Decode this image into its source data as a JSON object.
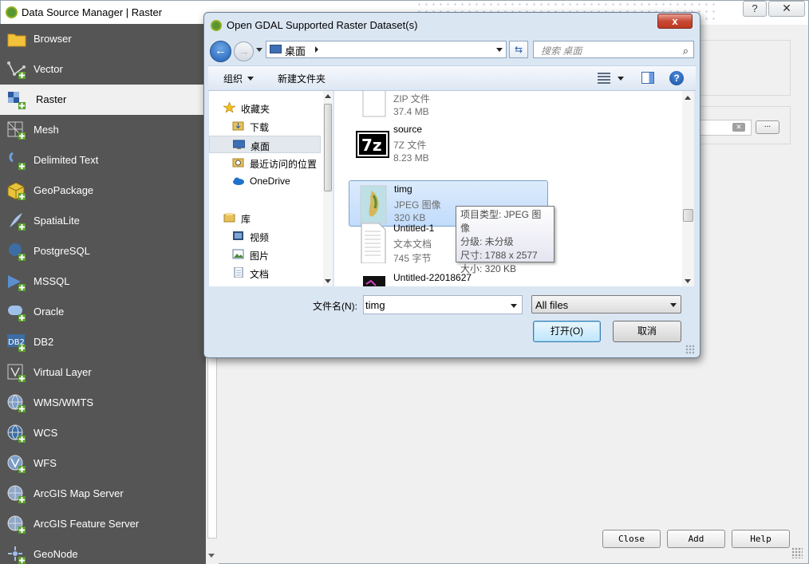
{
  "main_window": {
    "title": "Data Source Manager | Raster",
    "help_label": "?",
    "close_label": "✕"
  },
  "sidebar": {
    "items": [
      {
        "label": "Browser",
        "icon": "folder-icon"
      },
      {
        "label": "Vector",
        "icon": "vector-icon"
      },
      {
        "label": "Raster",
        "icon": "raster-icon"
      },
      {
        "label": "Mesh",
        "icon": "mesh-icon"
      },
      {
        "label": "Delimited Text",
        "icon": "delimited-text-icon"
      },
      {
        "label": "GeoPackage",
        "icon": "geopackage-icon"
      },
      {
        "label": "SpatiaLite",
        "icon": "spatialite-icon"
      },
      {
        "label": "PostgreSQL",
        "icon": "postgresql-icon"
      },
      {
        "label": "MSSQL",
        "icon": "mssql-icon"
      },
      {
        "label": "Oracle",
        "icon": "oracle-icon"
      },
      {
        "label": "DB2",
        "icon": "db2-icon"
      },
      {
        "label": "Virtual Layer",
        "icon": "virtual-layer-icon"
      },
      {
        "label": "WMS/WMTS",
        "icon": "wms-icon"
      },
      {
        "label": "WCS",
        "icon": "wcs-icon"
      },
      {
        "label": "WFS",
        "icon": "wfs-icon"
      },
      {
        "label": "ArcGIS Map Server",
        "icon": "arcgis-map-icon"
      },
      {
        "label": "ArcGIS Feature Server",
        "icon": "arcgis-feature-icon"
      },
      {
        "label": "GeoNode",
        "icon": "geonode-icon"
      }
    ],
    "active_index": 2
  },
  "source_panel": {
    "browse_label": "...",
    "clear_label": "✕"
  },
  "bottom_buttons": {
    "close": "Close",
    "add": "Add",
    "help": "Help"
  },
  "dialog": {
    "title": "Open GDAL Supported Raster Dataset(s)",
    "close_label": "x",
    "address": "桌面",
    "search_placeholder": "搜索 桌面",
    "toolbar": {
      "organize": "组织",
      "new_folder": "新建文件夹",
      "help": "?"
    },
    "nav_items": [
      {
        "label": "收藏夹",
        "icon": "star-icon"
      },
      {
        "label": "下载",
        "icon": "downloads-folder-icon"
      },
      {
        "label": "桌面",
        "icon": "desktop-icon"
      },
      {
        "label": "最近访问的位置",
        "icon": "recent-places-icon"
      },
      {
        "label": "OneDrive",
        "icon": "onedrive-icon"
      },
      {
        "label": "库",
        "icon": "library-icon"
      },
      {
        "label": "视频",
        "icon": "video-icon"
      },
      {
        "label": "图片",
        "icon": "pictures-icon"
      },
      {
        "label": "文档",
        "icon": "documents-icon"
      }
    ],
    "files": [
      {
        "name": "",
        "type": "ZIP 文件",
        "size": "37.4 MB",
        "icon": "zip-file-icon"
      },
      {
        "name": "source",
        "type": "7Z 文件",
        "size": "8.23 MB",
        "icon": "7z-file-icon"
      },
      {
        "name": "timg",
        "type": "JPEG 图像",
        "size": "320 KB",
        "icon": "jpeg-thumbnail-icon"
      },
      {
        "name": "Untitled-1",
        "type": "文本文档",
        "size": "745 字节",
        "icon": "text-file-icon"
      },
      {
        "name": "Untitled-22018627",
        "type": "",
        "size": "",
        "icon": "image-file-icon"
      }
    ],
    "tooltip": {
      "type_line": "项目类型: JPEG 图像",
      "rating_line": "分级: 未分级",
      "dims_line": "尺寸: 1788 x 2577",
      "size_line": "大小: 320 KB"
    },
    "filename_label": "文件名(N):",
    "filename_value": "timg",
    "filetype_value": "All files",
    "open_label": "打开(O)",
    "cancel_label": "取消"
  }
}
